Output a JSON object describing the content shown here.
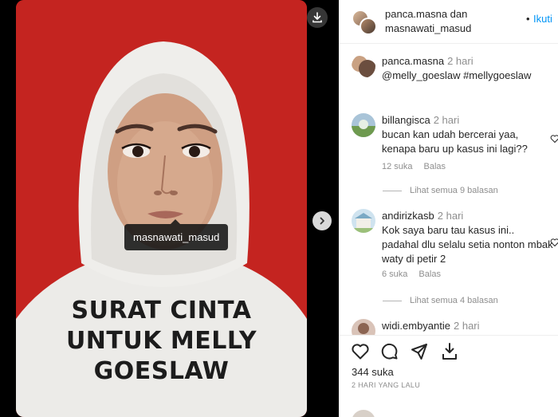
{
  "post": {
    "tag_username": "masnawati_masud",
    "caption_lines": [
      "SURAT CINTA",
      "UNTUK MELLY",
      "GOESLAW"
    ]
  },
  "header": {
    "names": "panca.masna dan masnawati_masud",
    "follow_dot": "•",
    "follow_label": "Ikuti"
  },
  "caption": {
    "username": "panca.masna",
    "time": "2 hari",
    "text": "@melly_goeslaw #mellygoeslaw"
  },
  "comments": [
    {
      "username": "billangisca",
      "time": "2 hari",
      "text": "bucan kan udah bercerai yaa, kenapa baru up kasus ini lagi??",
      "likes": "12 suka",
      "reply_label": "Balas",
      "view_replies": "Lihat semua 9 balasan"
    },
    {
      "username": "andirizkasb",
      "time": "2 hari",
      "text": "Kok saya baru tau kasus ini.. padahal dlu selalu setia nonton mbak waty di petir 2",
      "likes": "6 suka",
      "reply_label": "Balas",
      "view_replies": "Lihat semua 4 balasan"
    },
    {
      "username": "widi.embyantie",
      "time": "2 hari",
      "text": ""
    }
  ],
  "footer": {
    "likes": "344 suka",
    "date": "2 HARI YANG LALU"
  },
  "icons": {
    "download": "download-icon",
    "next": "chevron-right-icon",
    "like": "heart-icon",
    "comment": "comment-icon",
    "share": "paper-plane-icon",
    "save": "save-icon"
  },
  "colors": {
    "photo_background": "#c42420",
    "link_blue": "#0095f6",
    "muted_text": "#8e8e8e"
  }
}
